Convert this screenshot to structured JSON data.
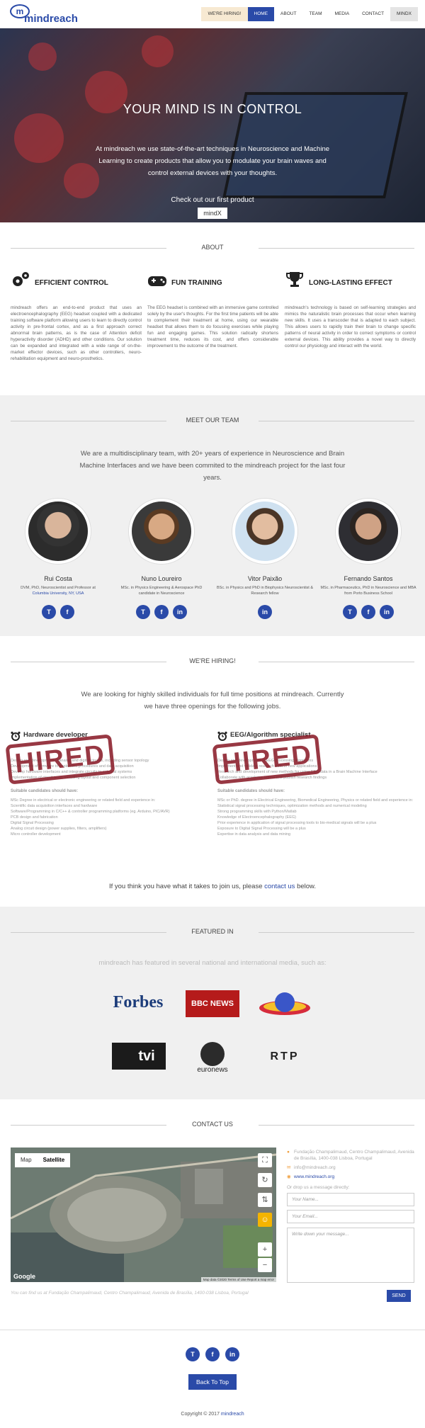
{
  "nav": {
    "logo_text": "mindreach",
    "logo_mark": "m",
    "items": [
      "WE'RE HIRING!",
      "HOME",
      "ABOUT",
      "TEAM",
      "MEDIA",
      "CONTACT",
      "mindX"
    ]
  },
  "hero": {
    "title": "YOUR MIND IS IN CONTROL",
    "text": "At mindreach we use state-of-the-art techniques in Neuroscience and Machine Learning to create products that allow you to modulate your brain waves and control external devices with your thoughts.",
    "cta": "Check out our first product",
    "button": "mindX"
  },
  "about": {
    "title": "ABOUT",
    "features": [
      {
        "icon": "gears-icon",
        "title": "EFFICIENT CONTROL",
        "text": "mindreach offers an end-to-end product that uses an electroencephalography (EEG) headset coupled with a dedicated training software platform allowing users to learn to directly control activity in pre-frontal cortex, and as a first approach correct abnormal brain patterns, as is the case of Attention deficit hyperactivity disorder (ADHD) and other conditions. Our solution can be expanded and integrated with a wide range of on-the-market effector devices, such as other controllers, neuro-rehabilitation equipment and neuro-prosthetics."
      },
      {
        "icon": "gamepad-icon",
        "title": "FUN TRAINING",
        "text": "The EEG headset is combined with an immersive game controlled solely by the user's thoughts. For the first time patients will be able to complement their treatment at home, using our wearable headset that allows them to do focusing exercises while playing fun and engaging games. This solution radically shortens treatment time, reduces its cost, and offers considerable improvement to the outcome of the treatment."
      },
      {
        "icon": "trophy-icon",
        "title": "LONG-LASTING EFFECT",
        "text": "mindreach's technology is based on self-learning strategies and mimics the naturalistic brain processes that occur when learning new skills. It uses a transcoder that is adapted to each subject. This allows users to rapidly train their brain to change specific patterns of neural activity in order to correct symptoms or control external devices. This ability provides a novel way to directly control our physiology and interact with the world."
      }
    ]
  },
  "team": {
    "title": "MEET OUR TEAM",
    "intro": "We are a multidisciplinary team, with 20+ years of experience in Neuroscience and Brain Machine Interfaces and we have been commited to the mindreach project for the last four years.",
    "members": [
      {
        "name": "Rui Costa",
        "desc": "DVM, PhD, Neuroscientist and Professor at",
        "link": "Columbia University, NY, USA",
        "socials": [
          "T",
          "f"
        ]
      },
      {
        "name": "Nuno Loureiro",
        "desc": "MSc. in Physics Engineering & Aerospace PhD candidate in Neuroscience",
        "link": "",
        "socials": [
          "T",
          "f",
          "in"
        ]
      },
      {
        "name": "Vitor Paixão",
        "desc": "BSc. in Physics and PhD in Biophysics Neuroscientist & Research fellow",
        "link": "",
        "socials": [
          "in"
        ]
      },
      {
        "name": "Fernando Santos",
        "desc": "MSc. in Pharmaceutics, PhD in Neuroscience and MBA from Porto Business School",
        "link": "",
        "socials": [
          "T",
          "f",
          "in"
        ]
      }
    ]
  },
  "hiring": {
    "title": "WE'RE HIRING!",
    "intro": "We are looking for highly skilled individuals for full time positions at mindreach. Currently we have three openings for the following jobs.",
    "stamp": "HIRED",
    "jobs": [
      {
        "title": "Hardware developer",
        "lines": [
          "Design and development of analog and digital circuits, including sensor topology",
          "Development of firmware to implement procedures and data acquisition",
          "Develop hardware interfaces and integrate circuits to external systems",
          "Implementation of circuit tests, including layout and component selection"
        ],
        "sub": "Suitable candidates should have:",
        "req": [
          "MSc Degree in electrical or electronic engineering or related field and experience in:",
          "Scientific data acquisition interfaces and hardware",
          "Software/Programming in C/C++ & controller programming platforms (eg. Arduino, PIC/AVR)",
          "PCB design and fabrication",
          "Digital Signal Processing",
          "Analog circuit design (power supplies, filters, amplifiers)",
          "Micro controller development"
        ]
      },
      {
        "title": "EEG/Algorithm specialist",
        "lines": [
          "Design and development of EEG processing algorithms",
          "Implement and validate research data of new applications",
          "Research and development of new methods for using EEG data in a Brain Machine Interface",
          "Collaborate with academic teams and publish research findings"
        ],
        "sub": "Suitable candidates should have:",
        "req": [
          "MSc or PhD. degree in Electrical Engineering, Biomedical Engineering, Physics or related field and experience in:",
          "Statistical signal processing techniques, optimization methods and numerical modeling",
          "Strong programming skills with Python/Matlab",
          "Knowledge of Electroencephalography (EEG)",
          "Prior experience in application of signal processing tools to bio-medical signals will be a plus",
          "Exposure to Digital Signal Processing will be a plus",
          "Expertise in data analysis and data mining"
        ]
      }
    ],
    "cta_pre": "If you think you have what it takes to join us, please ",
    "cta_link": "contact us",
    "cta_post": " below."
  },
  "featured": {
    "title": "FEATURED IN",
    "intro": "mindreach has featured in several national and international media, such as:",
    "media": [
      "Forbes",
      "BBC NEWS",
      "RTP",
      "tvi",
      "euronews",
      "RTP"
    ]
  },
  "contact": {
    "title": "CONTACT US",
    "map_tabs": [
      "Map",
      "Satellite"
    ],
    "map_footer": "Map data ©2020  Terms of Use  Report a map error",
    "map_brand": "Google",
    "address": "Fundação Champalimaud, Centro Champalimaud, Avenida de Brasília, 1400-038 Lisboa, Portugal",
    "email": "info@mindreach.org",
    "website": "www.mindreach.org",
    "prompt": "Or drop us a message directly:",
    "name_placeholder": "Your Name...",
    "email_placeholder": "Your Email...",
    "message_placeholder": "Write down your message...",
    "send": "SEND",
    "footnote": "You can find us at Fundação Champalimaud, Centro Champalimaud, Avenida de Brasília, 1400-038 Lisboa, Portugal"
  },
  "footer": {
    "socials": [
      "T",
      "f",
      "in"
    ],
    "top_button": "Back To Top",
    "copyright": "Copyright © 2017",
    "brand": "mindreach"
  },
  "colors": {
    "brand": "#2a4aa8",
    "hired_stamp": "#8a1d2a"
  }
}
